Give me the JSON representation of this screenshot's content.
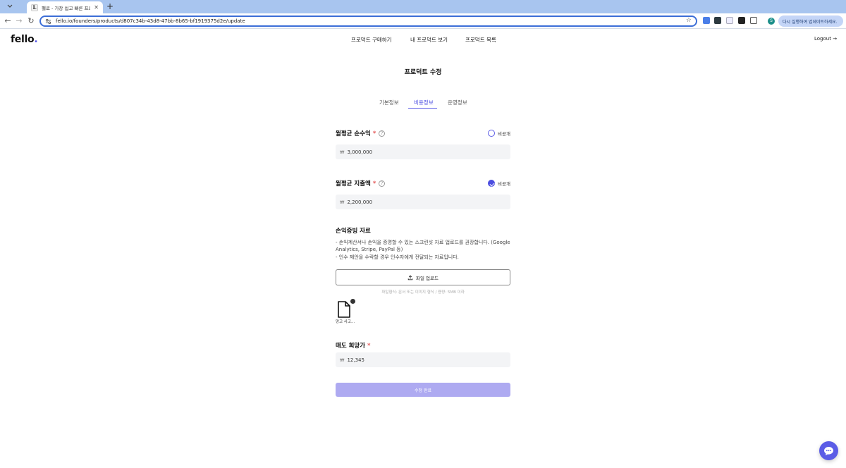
{
  "browser": {
    "tab_title": "펠로 - 가장 쉽고 빠른 프로덕트 M...",
    "tab_favicon_letter": "L",
    "new_tab": "+",
    "url": "fello.io/founders/products/d807c34b-43d8-47bb-8b65-bf1919375d2e/update",
    "profile_initial": "S",
    "update_button": "다시 실행하여 업데이트하세요."
  },
  "header": {
    "logo_text": "fello",
    "logo_dot": ".",
    "nav": [
      "프로덕트 구매하기",
      "내 프로덕트 보기",
      "프로덕트 목록"
    ],
    "logout": "Logout →"
  },
  "page": {
    "title": "프로덕트 수정",
    "tabs": [
      {
        "label": "기본정보",
        "active": false
      },
      {
        "label": "비용정보",
        "active": true
      },
      {
        "label": "운영정보",
        "active": false
      }
    ]
  },
  "form": {
    "avg_profit": {
      "label": "월평균 순수익",
      "required": "*",
      "help": "?",
      "private_label": "비공개",
      "private_checked": false,
      "currency": "₩",
      "value": "3,000,000"
    },
    "avg_expense": {
      "label": "월평균 지출액",
      "required": "*",
      "help": "?",
      "private_label": "비공개",
      "private_checked": true,
      "currency": "₩",
      "value": "2,200,000"
    },
    "evidence": {
      "title": "손익증빙 자료",
      "desc1": "- 손익계산서나 손익을 증명할 수 있는 스크린샷 자료 업로드를 권장합니다. (Google Analytics, Stripe, PayPal 등)",
      "desc2": "- 인수 제안을 수락할 경우 인수자에게 전달되는 자료입니다.",
      "upload_label": "파일 업로드",
      "upload_hint": "파일형식: 문서 또는 이미지 형식 / 용량: 5MB 이하",
      "file_name": "망고 사고..."
    },
    "asking_price": {
      "label": "매도 희망가",
      "required": "*",
      "currency": "₩",
      "value": "12,345"
    },
    "submit_label": "수정 완료"
  },
  "colors": {
    "accent": "#5b5ce6",
    "submit_disabled": "#aeaaf1",
    "input_bg": "#f3f4f6"
  }
}
